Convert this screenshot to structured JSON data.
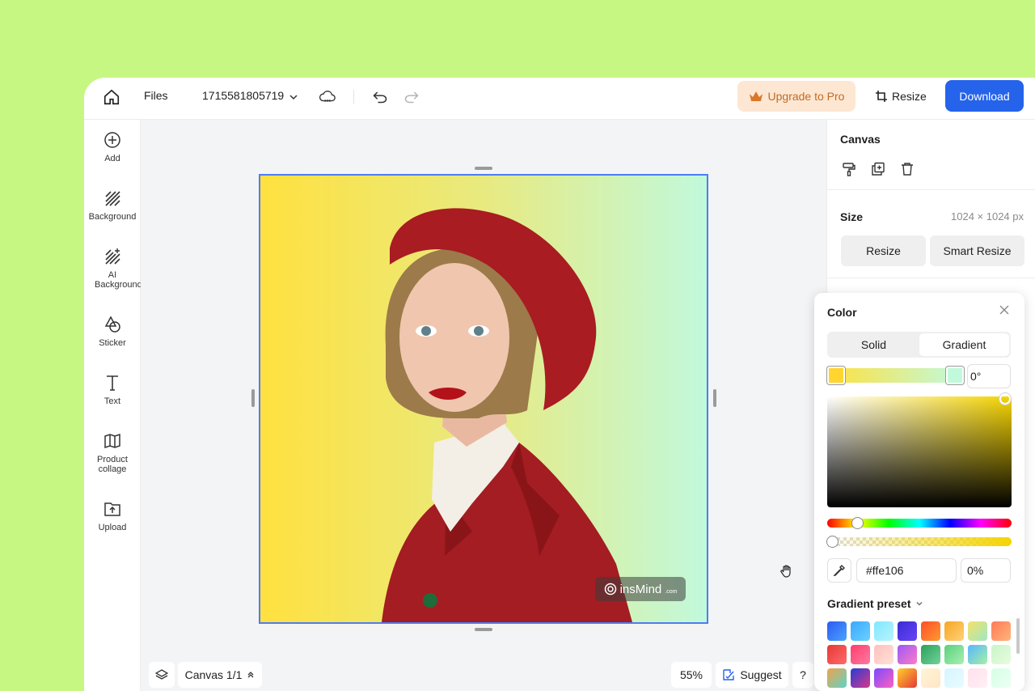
{
  "topbar": {
    "files_label": "Files",
    "document_name": "1715581805719",
    "upgrade_label": "Upgrade to Pro",
    "resize_label": "Resize",
    "download_label": "Download"
  },
  "sidebar": {
    "items": [
      {
        "label": "Add",
        "icon": "plus-circle-icon"
      },
      {
        "label": "Background",
        "icon": "hatch-icon"
      },
      {
        "label": "AI Background",
        "icon": "ai-hatch-icon"
      },
      {
        "label": "Sticker",
        "icon": "shapes-icon"
      },
      {
        "label": "Text",
        "icon": "text-icon"
      },
      {
        "label": "Product collage",
        "icon": "map-icon"
      },
      {
        "label": "Upload",
        "icon": "upload-icon"
      }
    ]
  },
  "canvas": {
    "watermark_text": "insMind",
    "watermark_suffix": ".com",
    "gradient": [
      "#ffe13f",
      "#c1f9dc"
    ]
  },
  "bottom_bar": {
    "canvas_label": "Canvas 1/1",
    "zoom": "55%",
    "suggest_label": "Suggest",
    "help_label": "?"
  },
  "right_panel": {
    "title": "Canvas",
    "size_label": "Size",
    "size_value": "1024 × 1024 px",
    "resize_label": "Resize",
    "smart_resize_label": "Smart Resize"
  },
  "color_popover": {
    "title": "Color",
    "tabs": [
      "Solid",
      "Gradient"
    ],
    "active_tab": "Gradient",
    "angle": "0°",
    "hex": "#ffe106",
    "opacity": "0%",
    "preset_label": "Gradient preset",
    "swatches": [
      "linear-gradient(135deg,#2c5bf0,#4aa3ff)",
      "linear-gradient(135deg,#3aa8ff,#6bd0ff)",
      "linear-gradient(135deg,#7ee8ff,#b8f3ff)",
      "linear-gradient(135deg,#3a2bd6,#6a45f5)",
      "linear-gradient(135deg,#ff4e2a,#ff9a2e)",
      "linear-gradient(135deg,#f5a623,#ffd27a)",
      "linear-gradient(135deg,#f6e16b,#9ee8c4)",
      "linear-gradient(135deg,#ff7a59,#ffb57a)",
      "linear-gradient(135deg,#e53935,#ff6b6b)",
      "linear-gradient(135deg,#ff3d6e,#ff7aa2)",
      "linear-gradient(135deg,#ffc0c0,#ffe1d6)",
      "linear-gradient(135deg,#9b59f5,#ff7ac8)",
      "linear-gradient(135deg,#2e9e5b,#6fd49a)",
      "linear-gradient(135deg,#5ad07a,#a8f0b4)",
      "linear-gradient(135deg,#58b6ff,#a6f0a6)",
      "linear-gradient(135deg,#c8f5c8,#e9fbe0)",
      "linear-gradient(135deg,#f0a34a,#5fd3c8)",
      "linear-gradient(135deg,#2a3bd6,#d63a8a)",
      "linear-gradient(135deg,#7a4bff,#ff5fc2)",
      "linear-gradient(135deg,#ffcf2e,#e53935)",
      "linear-gradient(135deg,#fff4d6,#ffe6c7)",
      "linear-gradient(135deg,#d6f5ff,#e8fbff)",
      "linear-gradient(135deg,#ffe0ec,#fff0f5)",
      "linear-gradient(135deg,#d6ffe6,#ecfff3)"
    ]
  }
}
